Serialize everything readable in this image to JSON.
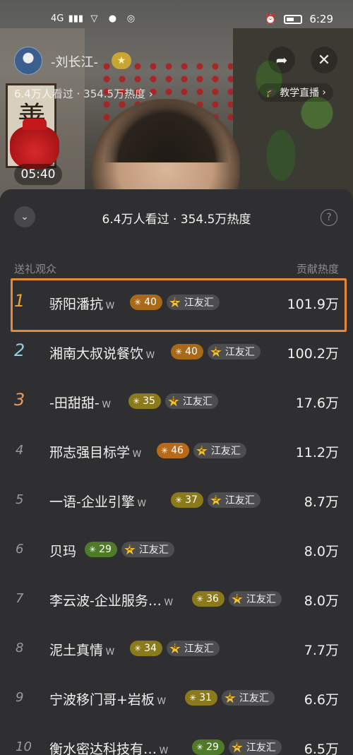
{
  "status_bar": {
    "network": "4G",
    "time": "6:29",
    "icons": [
      "signal-icon",
      "vpn-shield-icon",
      "chat-icon",
      "radio-icon",
      "alarm-icon",
      "battery-icon"
    ]
  },
  "live_header": {
    "host_name": "-刘长江-",
    "viewer_stats": "6.4万人看过 · 354.5万热度",
    "viewer_stats_arrow": "›",
    "category_tag": "教学直播",
    "category_arrow": "›",
    "timer": "05:40",
    "share_icon": "share-arrow-icon",
    "close_icon": "close-icon"
  },
  "sheet": {
    "title": "6.4万人看过 · 354.5万热度",
    "collapse_glyph": "⌄",
    "help_glyph": "?",
    "col_left": "送礼观众",
    "col_right": "贡献热度",
    "rows": [
      {
        "rank": "1",
        "name": "骄阳潘抗",
        "level": "40",
        "level_color": "#a86a18",
        "club_rank": "1",
        "club": "江友汇",
        "heat": "101.9万"
      },
      {
        "rank": "2",
        "name": "湘南大叔说餐饮",
        "level": "40",
        "level_color": "#a86a18",
        "club_rank": "2",
        "club": "江友汇",
        "heat": "100.2万"
      },
      {
        "rank": "3",
        "name": "-田甜甜-",
        "level": "35",
        "level_color": "#8a7a1c",
        "club_rank": "4",
        "club": "江友汇",
        "heat": "17.6万"
      },
      {
        "rank": "4",
        "name": "邢志强目标学",
        "level": "46",
        "level_color": "#b86a1a",
        "club_rank": "2",
        "club": "江友汇",
        "heat": "11.2万"
      },
      {
        "rank": "5",
        "name": "一语-企业引擎",
        "level": "37",
        "level_color": "#8a7a1c",
        "club_rank": "3",
        "club": "江友汇",
        "heat": "8.7万"
      },
      {
        "rank": "6",
        "name": "贝玛",
        "level": "29",
        "level_color": "#4f7a2a",
        "club_rank": "2",
        "club": "江友汇",
        "heat": "8.0万"
      },
      {
        "rank": "7",
        "name": "李云波-企业服务…",
        "level": "36",
        "level_color": "#8a7a1c",
        "club_rank": "4",
        "club": "江友汇",
        "heat": "8.0万"
      },
      {
        "rank": "8",
        "name": "泥土真情",
        "level": "34",
        "level_color": "#8a7a1c",
        "club_rank": "4",
        "club": "江友汇",
        "heat": "7.7万"
      },
      {
        "rank": "9",
        "name": "宁波移门哥+岩板",
        "level": "31",
        "level_color": "#8a7a1c",
        "club_rank": "2",
        "club": "江友汇",
        "heat": "6.6万"
      },
      {
        "rank": "10",
        "name": "衡水密达科技有…",
        "level": "29",
        "level_color": "#4f7a2a",
        "club_rank": "2",
        "club": "江友汇",
        "heat": "6.5万"
      }
    ],
    "rank_colors": {
      "1": "#e8a33a",
      "2": "#8fd0e0",
      "3": "#e89a60",
      "other": "#9a9a9c"
    },
    "butterfly_glyph": "Ꮃ"
  }
}
